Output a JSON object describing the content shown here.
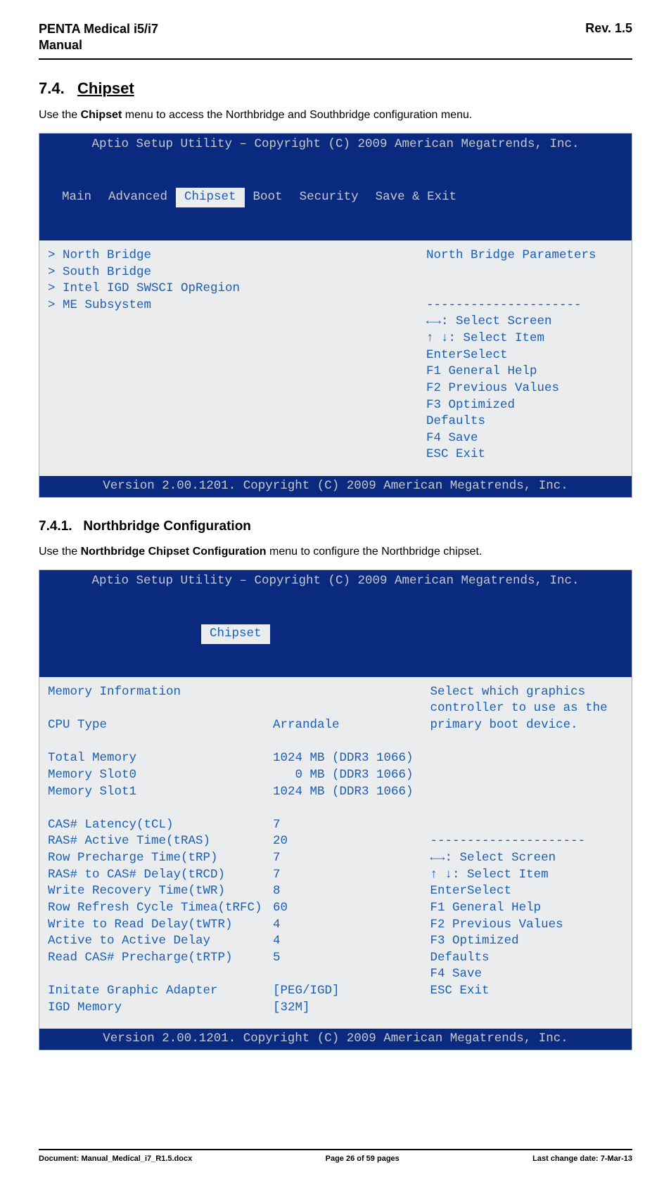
{
  "header": {
    "product_left": "PENTA Medical i5/i7\nManual",
    "rev": "Rev. 1.5"
  },
  "section": {
    "heading_num": "7.4.",
    "heading_name": "Chipset",
    "intro_a": "Use the ",
    "intro_bold": "Chipset",
    "intro_b": " menu to access the Northbridge and Southbridge configuration menu."
  },
  "bios1": {
    "title": "Aptio Setup Utility – Copyright (C) 2009 American Megatrends, Inc.",
    "tabs": [
      "Main",
      "Advanced",
      "Chipset",
      "Boot",
      "Security",
      "Save & Exit"
    ],
    "active_tab": "Chipset",
    "left_lines": [
      "> North Bridge",
      "> South Bridge",
      "> Intel IGD SWSCI OpRegion",
      "> ME Subsystem"
    ],
    "right_help": "North Bridge Parameters",
    "sep_line": "---------------------",
    "hints": [
      "←→: Select Screen",
      "↑ ↓: Select Item",
      "EnterSelect",
      "F1   General Help",
      "F2   Previous Values",
      "F3   Optimized",
      "Defaults",
      "F4    Save",
      "ESC   Exit"
    ],
    "footer": "Version 2.00.1201. Copyright (C) 2009 American Megatrends, Inc."
  },
  "sub": {
    "heading_num": "7.4.1.",
    "heading_name": "Northbridge Configuration",
    "intro_a": "Use the ",
    "intro_bold": "Northbridge Chipset Configuration",
    "intro_b": " menu to configure the Northbridge chipset."
  },
  "bios2": {
    "title": "Aptio Setup Utility – Copyright (C) 2009 American Megatrends, Inc.",
    "active_tab": "Chipset",
    "rows": [
      {
        "label": "Memory Information",
        "value": ""
      },
      {
        "label": "",
        "value": ""
      },
      {
        "label": "CPU Type",
        "value": "Arrandale"
      },
      {
        "label": "",
        "value": ""
      },
      {
        "label": "Total Memory",
        "value": "1024 MB (DDR3 1066)"
      },
      {
        "label": "Memory Slot0",
        "value": "   0 MB (DDR3 1066)"
      },
      {
        "label": "Memory Slot1",
        "value": "1024 MB (DDR3 1066)"
      },
      {
        "label": "",
        "value": ""
      },
      {
        "label": "CAS# Latency(tCL)",
        "value": "7"
      },
      {
        "label": "RAS# Active Time(tRAS)",
        "value": "20"
      },
      {
        "label": "Row Precharge Time(tRP)",
        "value": "7"
      },
      {
        "label": "RAS# to CAS# Delay(tRCD)",
        "value": "7"
      },
      {
        "label": "Write Recovery Time(tWR)",
        "value": "8"
      },
      {
        "label": "Row Refresh Cycle Timea(tRFC)",
        "value": "60"
      },
      {
        "label": "Write to Read Delay(tWTR)",
        "value": "4"
      },
      {
        "label": "Active to Active Delay",
        "value": "4"
      },
      {
        "label": "Read CAS# Precharge(tRTP)",
        "value": "5"
      },
      {
        "label": "",
        "value": ""
      },
      {
        "label": "Initate Graphic Adapter",
        "value": "[PEG/IGD]"
      },
      {
        "label": "IGD Memory",
        "value": "[32M]"
      }
    ],
    "right_help_lines": [
      "Select which graphics",
      "controller to use as the",
      "primary boot device."
    ],
    "sep_line": "---------------------",
    "hints": [
      "←→: Select Screen",
      "↑ ↓: Select Item",
      "EnterSelect",
      "F1   General Help",
      "F2   Previous Values",
      "F3   Optimized",
      "Defaults",
      "F4    Save",
      "ESC   Exit"
    ],
    "footer": "Version 2.00.1201. Copyright (C) 2009 American Megatrends, Inc."
  },
  "footer": {
    "doc": "Document: Manual_Medical_i7_R1.5.docx",
    "page": "Page 26 of 59 pages",
    "date": "Last change date: 7-Mar-13"
  }
}
